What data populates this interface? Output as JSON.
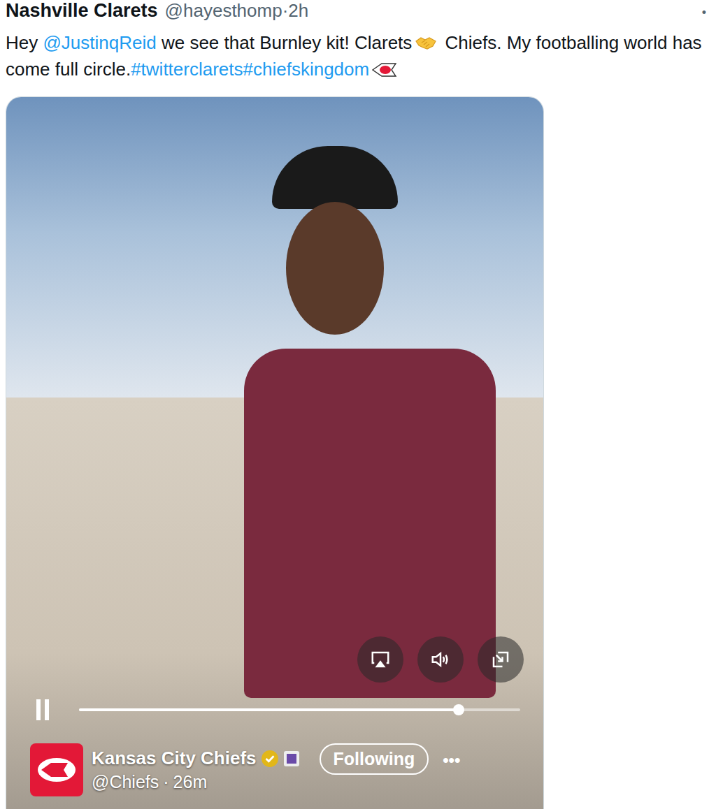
{
  "tweet": {
    "author": "Nashville Clarets",
    "handle": "@hayesthomp",
    "separator": "·",
    "time": "2h",
    "more": "•",
    "text_before": "Hey ",
    "mention": "@JustinqReid",
    "text_middle": " we see that Burnley kit! Clarets",
    "text_after": " Chiefs. My footballing world has come full circle.",
    "hashtags": [
      "#twitterclarets",
      "#chiefskingdom"
    ]
  },
  "video": {
    "playing": true,
    "muted": false,
    "progress": 0.86,
    "author": "Kansas City Chiefs",
    "verified": true,
    "handle": "@Chiefs",
    "separator": "·",
    "time": "26m",
    "follow_label": "Following",
    "more": "•••"
  }
}
